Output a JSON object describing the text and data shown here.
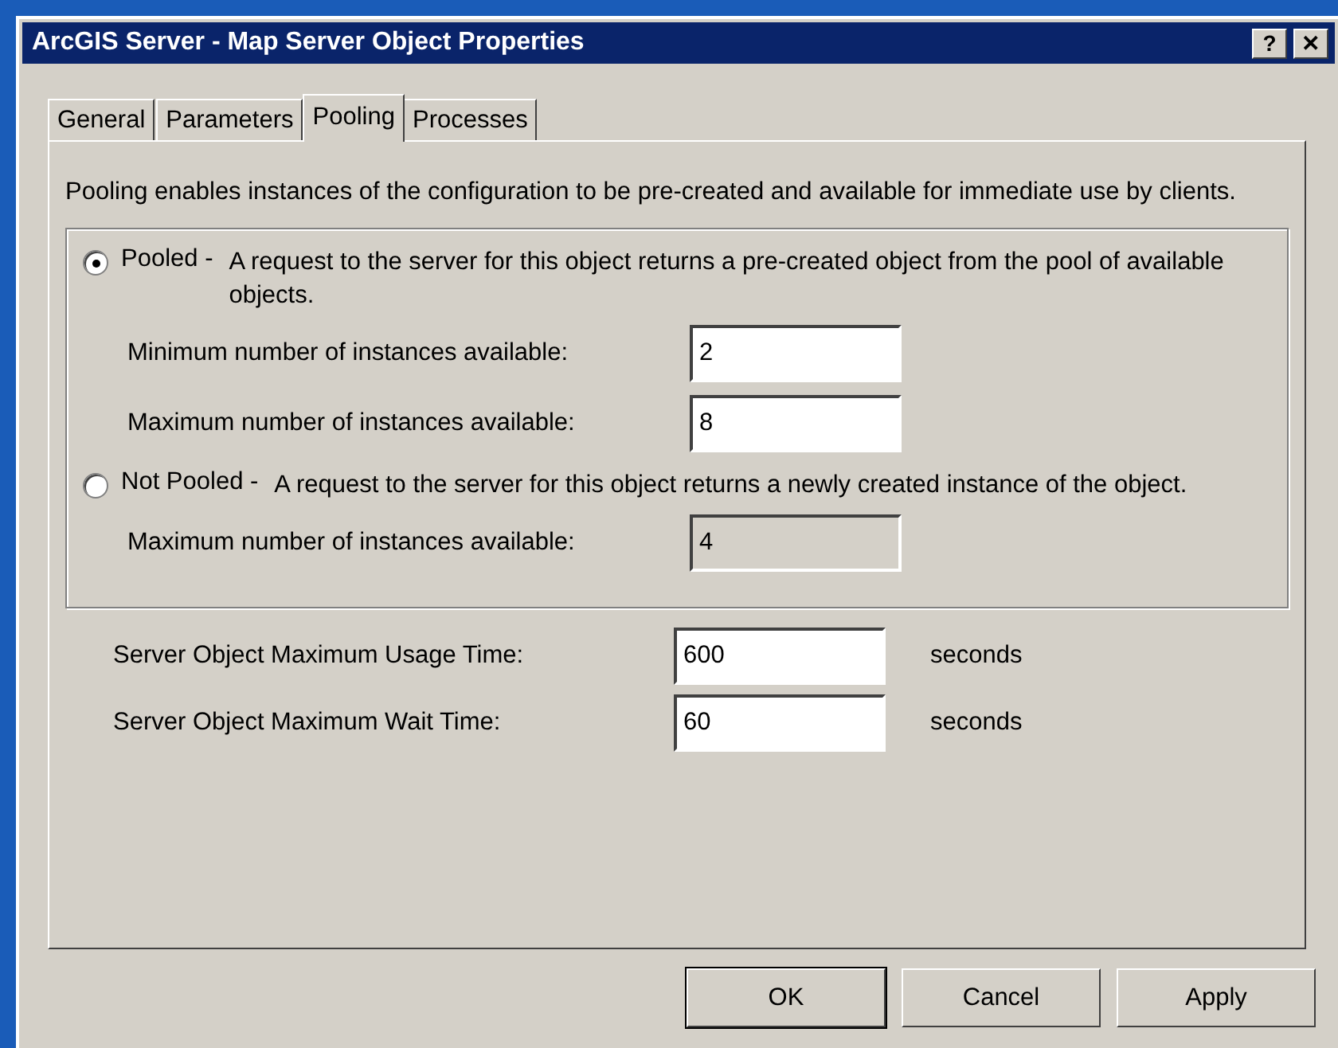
{
  "window": {
    "title": "ArcGIS Server - Map Server Object Properties",
    "help": "?",
    "close": "✕"
  },
  "tabs": [
    {
      "label": "General",
      "selected": false
    },
    {
      "label": "Parameters",
      "selected": false
    },
    {
      "label": "Pooling",
      "selected": true
    },
    {
      "label": "Processes",
      "selected": false
    }
  ],
  "intro": "Pooling enables instances of the configuration to be pre-created and available for immediate use by clients.",
  "options": [
    {
      "label": "Pooled -",
      "description": "A request to the server for this object returns a pre-created object from the pool of available objects.",
      "selected": true,
      "fields": [
        {
          "label": "Minimum number of instances available:",
          "value": "2",
          "disabled": false
        },
        {
          "label": "Maximum number of instances available:",
          "value": "8",
          "disabled": false
        }
      ]
    },
    {
      "label": "Not Pooled -",
      "description": "A request to the server for this object returns a newly created instance of the object.",
      "selected": false,
      "fields": [
        {
          "label": "Maximum number of instances available:",
          "value": "4",
          "disabled": true
        }
      ]
    }
  ],
  "timeouts": [
    {
      "label": "Server Object Maximum Usage Time:",
      "value": "600",
      "unit": "seconds"
    },
    {
      "label": "Server Object Maximum Wait Time:",
      "value": "60",
      "unit": "seconds"
    }
  ],
  "buttons": [
    {
      "label": "OK",
      "default": true
    },
    {
      "label": "Cancel",
      "default": false
    },
    {
      "label": "Apply",
      "default": false
    }
  ]
}
